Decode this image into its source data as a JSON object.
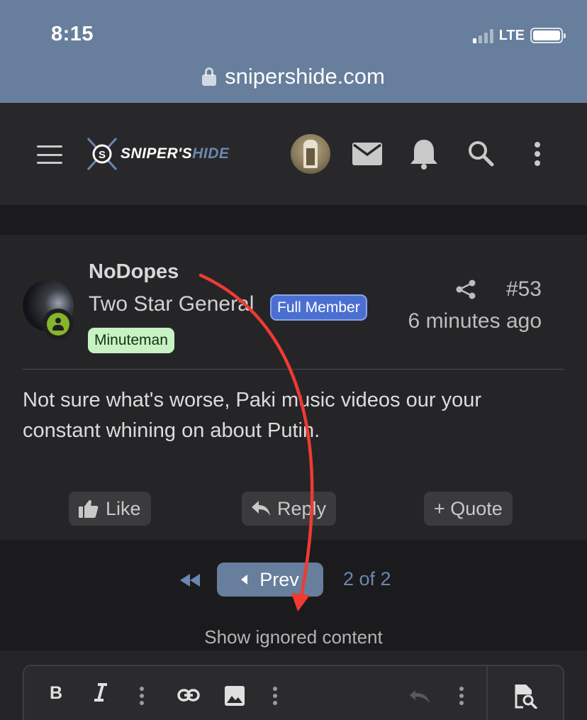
{
  "status_bar": {
    "time": "8:15",
    "network": "LTE"
  },
  "browser": {
    "url": "snipershide.com"
  },
  "header": {
    "logo_main": "SNIPER'S",
    "logo_accent": "HIDE",
    "icons": [
      "menu-icon",
      "mail-icon",
      "bell-icon",
      "search-icon",
      "more-vertical-icon"
    ]
  },
  "post": {
    "username": "NoDopes",
    "user_title": "Two Star General",
    "member_badge": "Full Member",
    "group_badge": "Minuteman",
    "post_number": "#53",
    "timestamp": "6 minutes ago",
    "body": "Not sure what's worse, Paki music videos our your constant whining on about Putin.",
    "actions": {
      "like": "Like",
      "reply": "Reply",
      "quote": "+ Quote"
    }
  },
  "pagination": {
    "prev_label": "Prev",
    "page_info": "2 of 2",
    "show_ignored": "Show ignored content"
  },
  "editor": {
    "tools": [
      "bold-icon",
      "italic-icon",
      "more-icon",
      "link-icon",
      "image-icon",
      "more-icon",
      "undo-icon",
      "more-icon",
      "preview-icon"
    ]
  },
  "colors": {
    "browser_bar": "#677e9c",
    "header_bg": "#28282a",
    "page_bg": "#1b1b1d",
    "post_bg": "#252527",
    "member_badge": "#4a6fd1",
    "minuteman_badge": "#c7f2c4",
    "online": "#84b52b",
    "link_blue": "#6c87b1",
    "annotation_arrow": "#ef3b32"
  }
}
